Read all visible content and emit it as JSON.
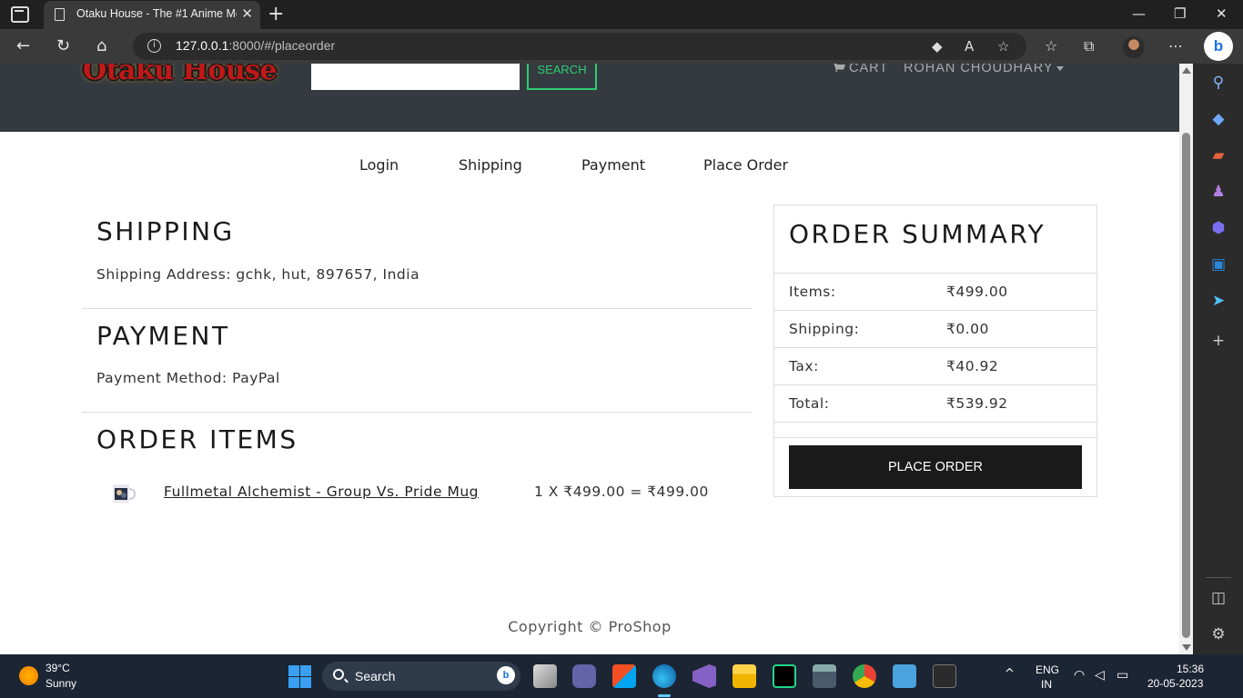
{
  "browser": {
    "tab_title": "Otaku House - The #1 Anime Me",
    "url_host": "127.0.0.1",
    "url_rest": ":8000/#/placeorder"
  },
  "site": {
    "logo": "Otaku House",
    "search_button": "SEARCH",
    "cart": "CART",
    "user": "ROHAN CHOUDHARY"
  },
  "steps": [
    "Login",
    "Shipping",
    "Payment",
    "Place Order"
  ],
  "shipping": {
    "heading": "SHIPPING",
    "address": "Shipping Address: gchk, hut, 897657, India"
  },
  "payment": {
    "heading": "PAYMENT",
    "method": "Payment Method: PayPal"
  },
  "order_items": {
    "heading": "ORDER ITEMS",
    "items": [
      {
        "name": "Fullmetal Alchemist - Group Vs. Pride Mug",
        "calc": "1 X ₹499.00 = ₹499.00"
      }
    ]
  },
  "summary": {
    "heading": "ORDER SUMMARY",
    "rows": [
      {
        "label": "Items:",
        "value": "₹499.00"
      },
      {
        "label": "Shipping:",
        "value": "₹0.00"
      },
      {
        "label": "Tax:",
        "value": "₹40.92"
      },
      {
        "label": "Total:",
        "value": "₹539.92"
      }
    ],
    "button": "PLACE ORDER"
  },
  "footer": "Copyright © ProShop",
  "taskbar": {
    "weather_temp": "39°C",
    "weather_cond": "Sunny",
    "search": "Search",
    "lang1": "ENG",
    "lang2": "IN",
    "time": "15:36",
    "date": "20-05-2023"
  },
  "colors": {
    "header_bg": "#343a40",
    "search_accent": "#2ecc71",
    "button_bg": "#1a1a1a",
    "taskbar_bg": "#1c2533"
  }
}
